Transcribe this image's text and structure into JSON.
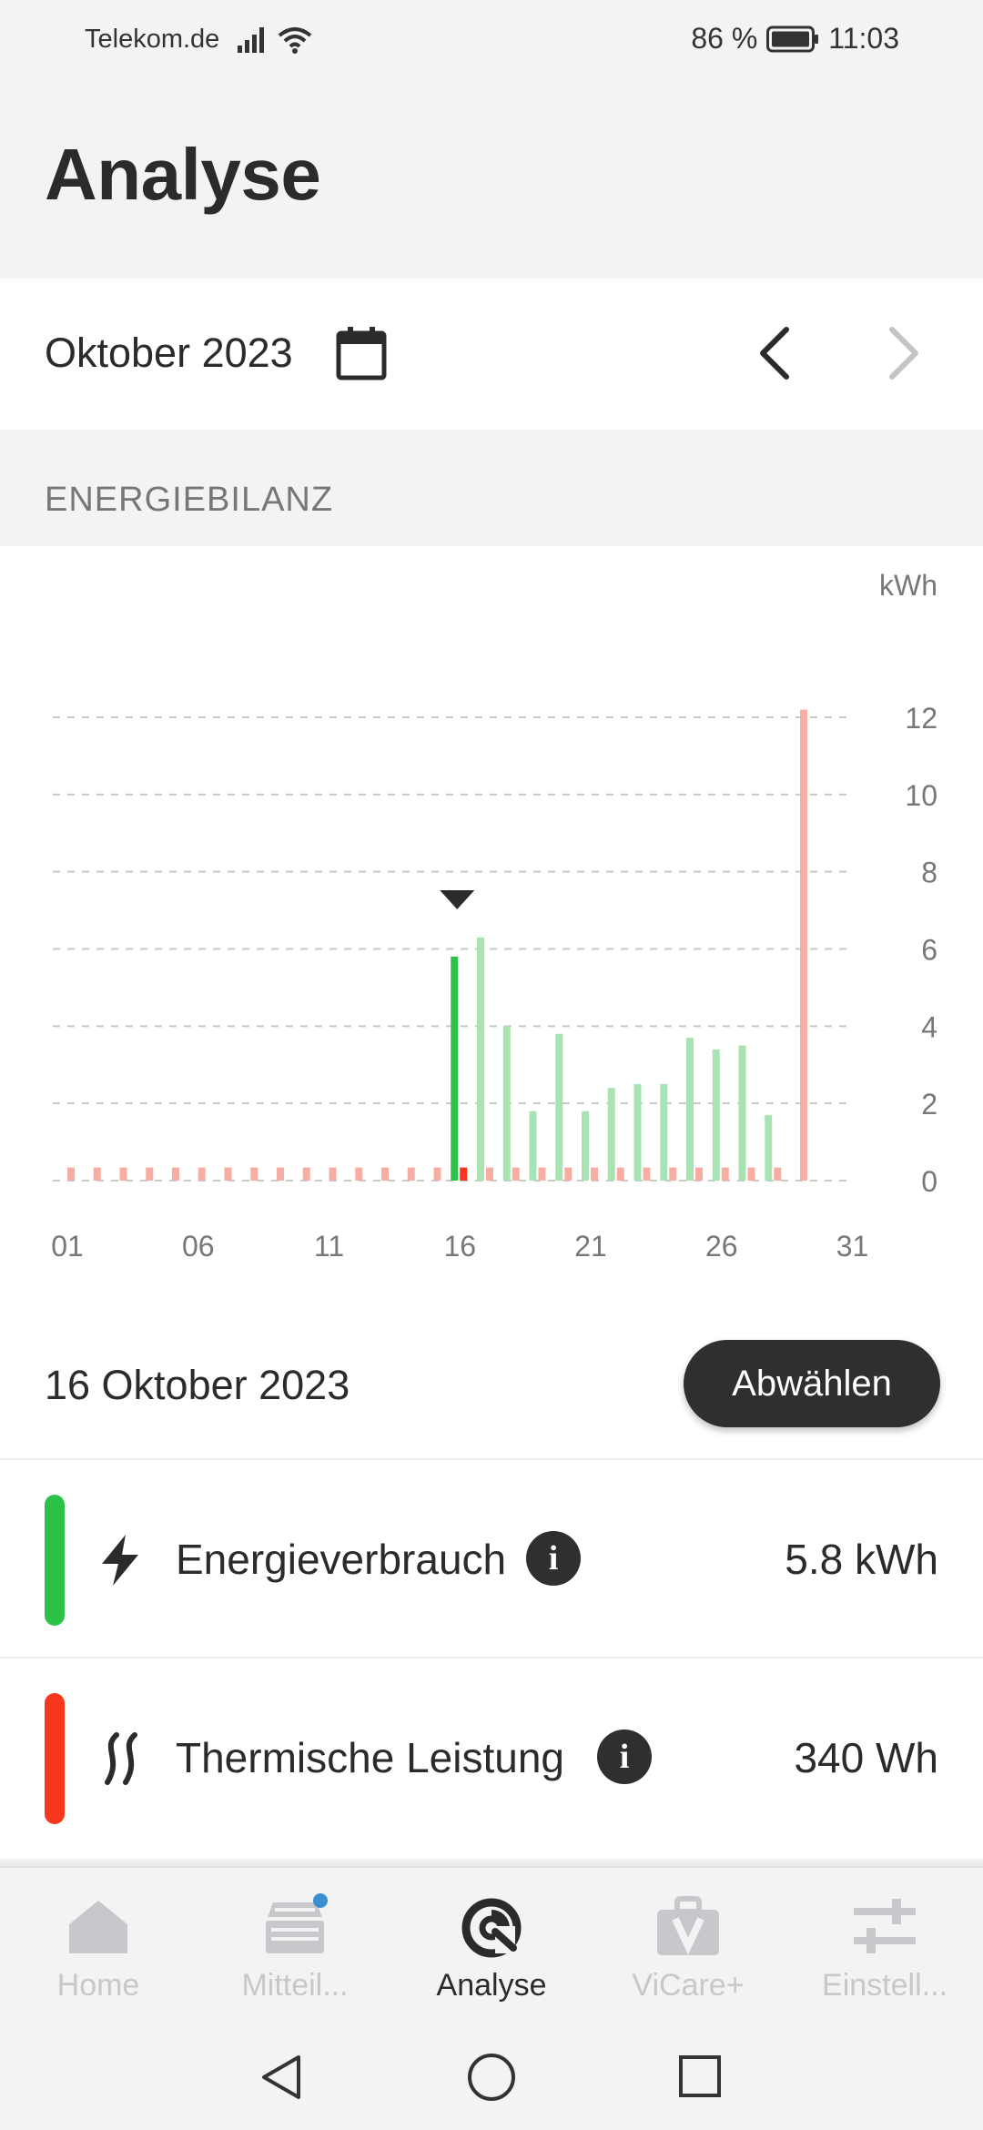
{
  "status": {
    "carrier": "Telekom.de",
    "battery": "86 %",
    "time": "11:03"
  },
  "page": {
    "title": "Analyse"
  },
  "period": {
    "label": "Oktober 2023"
  },
  "section": {
    "title": "ENERGIEBILANZ"
  },
  "chart_data": {
    "type": "bar",
    "unit": "kWh",
    "x": [
      1,
      2,
      3,
      4,
      5,
      6,
      7,
      8,
      9,
      10,
      11,
      12,
      13,
      14,
      15,
      16,
      17,
      18,
      19,
      20,
      21,
      22,
      23,
      24,
      25,
      26,
      27,
      28,
      29,
      30,
      31
    ],
    "x_ticks": [
      "01",
      "06",
      "11",
      "16",
      "21",
      "26",
      "31"
    ],
    "y_ticks": [
      "0",
      "2",
      "4",
      "6",
      "8",
      "10",
      "12"
    ],
    "ylim": [
      0,
      12
    ],
    "grid": true,
    "selected_day": 16,
    "series": [
      {
        "key": "energy",
        "color": "#2cc24a",
        "values": [
          0,
          0,
          0,
          0,
          0,
          0,
          0,
          0,
          0,
          0,
          0,
          0,
          0,
          0,
          0,
          5.8,
          6.3,
          4.0,
          1.8,
          3.8,
          1.8,
          2.4,
          2.5,
          2.5,
          3.7,
          3.4,
          3.5,
          1.7,
          0,
          0,
          0
        ]
      },
      {
        "key": "thermal",
        "color": "#f5371d",
        "values": [
          0.34,
          0.34,
          0.34,
          0.34,
          0.34,
          0.34,
          0.34,
          0.34,
          0.34,
          0.34,
          0.34,
          0.34,
          0.34,
          0.34,
          0.34,
          0.34,
          0.34,
          0.34,
          0.34,
          0.34,
          0.34,
          0.34,
          0.34,
          0.34,
          0.34,
          0.34,
          0.34,
          0.34,
          12.2,
          0,
          0
        ]
      }
    ]
  },
  "selection": {
    "date": "16 Oktober 2023",
    "deselect_label": "Abwählen"
  },
  "metrics": [
    {
      "label": "Energieverbrauch",
      "value": "5.8 kWh",
      "color": "#2cc24a",
      "icon": "lightning-icon"
    },
    {
      "label": "Thermische Leistung",
      "value": "340 Wh",
      "color": "#f5371d",
      "icon": "heat-waves-icon"
    }
  ],
  "tabs": [
    {
      "label": "Home",
      "icon": "home-icon",
      "active": false
    },
    {
      "label": "Mitteil...",
      "icon": "messages-icon",
      "active": false,
      "badge_color": "#3a8ed1"
    },
    {
      "label": "Analyse",
      "icon": "analysis-icon",
      "active": true
    },
    {
      "label": "ViCare+",
      "icon": "vicare-bag-icon",
      "active": false
    },
    {
      "label": "Einstell...",
      "icon": "sliders-icon",
      "active": false
    }
  ]
}
